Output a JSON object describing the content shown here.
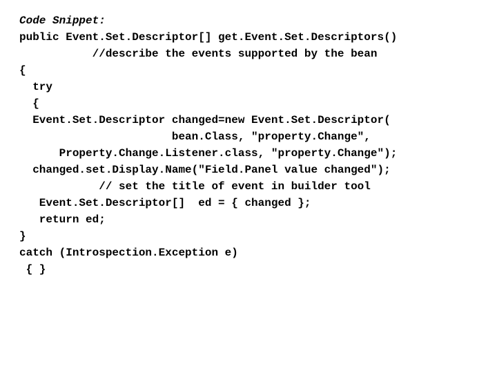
{
  "lines": [
    {
      "text": "Code Snippet:",
      "heading": true
    },
    {
      "text": "public Event.Set.Descriptor[] get.Event.Set.Descriptors()"
    },
    {
      "text": "           //describe the events supported by the bean"
    },
    {
      "text": "{"
    },
    {
      "text": "  try"
    },
    {
      "text": "  {"
    },
    {
      "text": "  Event.Set.Descriptor changed=new Event.Set.Descriptor("
    },
    {
      "text": "                       bean.Class, \"property.Change\","
    },
    {
      "text": "      Property.Change.Listener.class, \"property.Change\");"
    },
    {
      "text": ""
    },
    {
      "text": "  changed.set.Display.Name(\"Field.Panel value changed\");"
    },
    {
      "text": "            // set the title of event in builder tool"
    },
    {
      "text": ""
    },
    {
      "text": "   Event.Set.Descriptor[]  ed = { changed };"
    },
    {
      "text": "   return ed;"
    },
    {
      "text": "}"
    },
    {
      "text": "catch (Introspection.Exception e)"
    },
    {
      "text": " { }"
    }
  ]
}
